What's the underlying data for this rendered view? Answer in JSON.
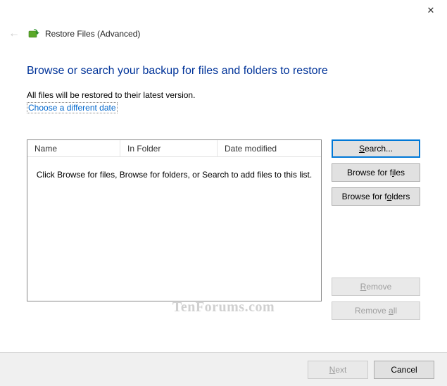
{
  "titlebar": {
    "close": "✕"
  },
  "header": {
    "back_arrow": "←",
    "app_title": "Restore Files (Advanced)"
  },
  "page": {
    "title": "Browse or search your backup for files and folders to restore",
    "sub_text": "All files will be restored to their latest version.",
    "date_link": "Choose a different date"
  },
  "listview": {
    "columns": {
      "name": "Name",
      "folder": "In Folder",
      "date": "Date modified"
    },
    "empty_msg": "Click Browse for files, Browse for folders, or Search to add files to this list."
  },
  "buttons": {
    "search_pre": "",
    "search_u": "S",
    "search_post": "earch...",
    "bfiles_pre": "Browse for f",
    "bfiles_u": "i",
    "bfiles_post": "les",
    "bfolders_pre": "Browse for f",
    "bfolders_u": "o",
    "bfolders_post": "lders",
    "remove_pre": "",
    "remove_u": "R",
    "remove_post": "emove",
    "removeall_pre": "Remove ",
    "removeall_u": "a",
    "removeall_post": "ll"
  },
  "footer": {
    "next_pre": "",
    "next_u": "N",
    "next_post": "ext",
    "cancel": "Cancel"
  },
  "watermark": "TenForums.com"
}
